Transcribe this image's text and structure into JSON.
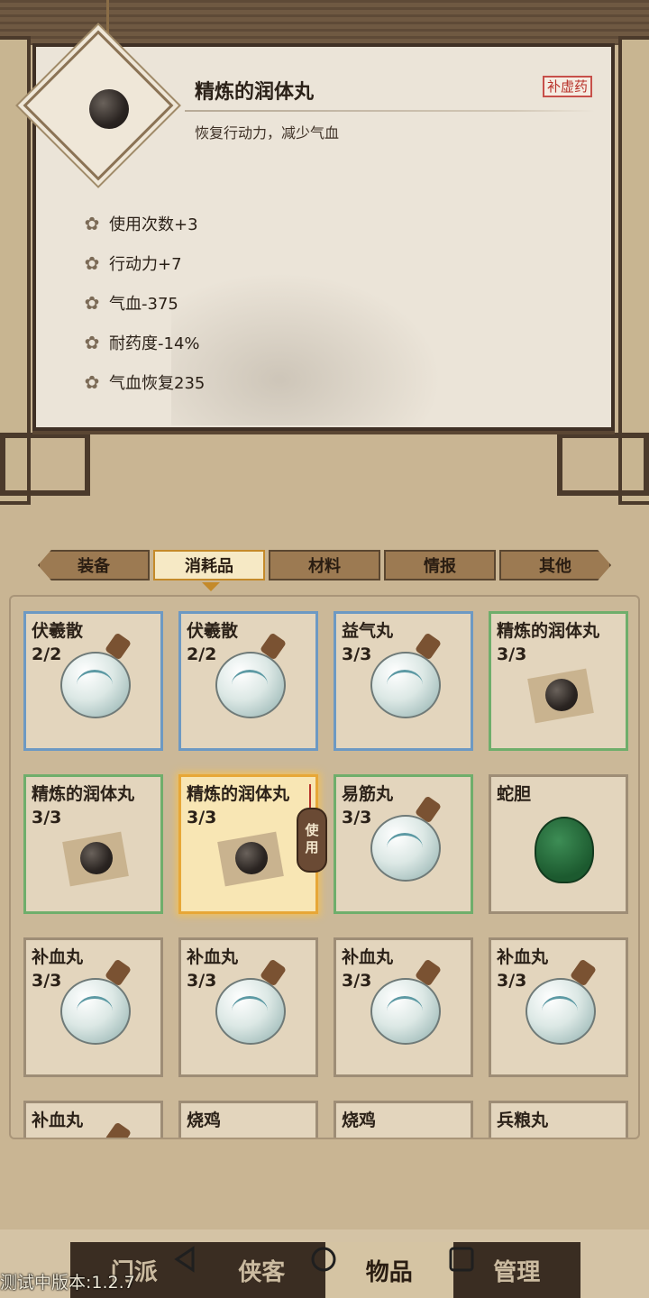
{
  "detail": {
    "title": "精炼的润体丸",
    "tag": "补虚药",
    "description": "恢复行动力，减少气血",
    "stats": [
      "使用次数+3",
      "行动力+7",
      "气血-375",
      "耐药度-14%",
      "气血恢复235"
    ]
  },
  "tabs": [
    {
      "label": "装备",
      "active": false
    },
    {
      "label": "消耗品",
      "active": true
    },
    {
      "label": "材料",
      "active": false
    },
    {
      "label": "情报",
      "active": false
    },
    {
      "label": "其他",
      "active": false
    }
  ],
  "items": [
    {
      "name": "伏羲散",
      "count": "2/2",
      "icon": "bottle-icon",
      "rarity": "blue"
    },
    {
      "name": "伏羲散",
      "count": "2/2",
      "icon": "bottle-icon",
      "rarity": "blue"
    },
    {
      "name": "益气丸",
      "count": "3/3",
      "icon": "bottle-icon",
      "rarity": "blue"
    },
    {
      "name": "精炼的润体丸",
      "count": "3/3",
      "icon": "pill-icon",
      "rarity": "green"
    },
    {
      "name": "精炼的润体丸",
      "count": "3/3",
      "icon": "pill-icon",
      "rarity": "green"
    },
    {
      "name": "精炼的润体丸",
      "count": "3/3",
      "icon": "pill-icon",
      "rarity": "selected",
      "use_label": "使用"
    },
    {
      "name": "易筋丸",
      "count": "3/3",
      "icon": "bottle-icon",
      "rarity": "green"
    },
    {
      "name": "蛇胆",
      "count": "",
      "icon": "gall-icon",
      "rarity": "gray"
    },
    {
      "name": "补血丸",
      "count": "3/3",
      "icon": "bottle-icon",
      "rarity": "gray"
    },
    {
      "name": "补血丸",
      "count": "3/3",
      "icon": "bottle-icon",
      "rarity": "gray"
    },
    {
      "name": "补血丸",
      "count": "3/3",
      "icon": "bottle-icon",
      "rarity": "gray"
    },
    {
      "name": "补血丸",
      "count": "3/3",
      "icon": "bottle-icon",
      "rarity": "gray"
    },
    {
      "name": "补血丸",
      "count": "",
      "icon": "bottle-icon",
      "rarity": "gray"
    },
    {
      "name": "烧鸡",
      "count": "",
      "icon": "chicken-icon",
      "rarity": "gray"
    },
    {
      "name": "烧鸡",
      "count": "",
      "icon": "chicken-icon",
      "rarity": "gray"
    },
    {
      "name": "兵粮丸",
      "count": "",
      "icon": "pill-icon",
      "rarity": "gray"
    }
  ],
  "nav": [
    {
      "label": "门派",
      "active": false
    },
    {
      "label": "侠客",
      "active": false
    },
    {
      "label": "物品",
      "active": true
    },
    {
      "label": "管理",
      "active": false
    }
  ],
  "version": "测试中版本:1.2.7"
}
